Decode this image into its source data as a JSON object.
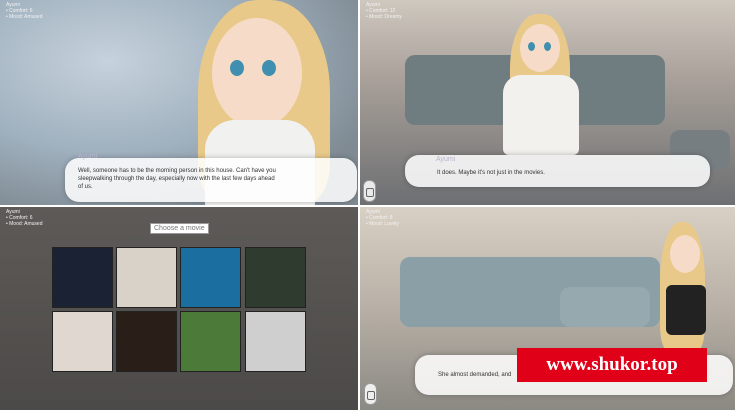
{
  "panel1": {
    "stats": [
      "Ayumi",
      "• Comfort: 6",
      "• Mood: Amused"
    ],
    "speaker": "Ayumi",
    "dialog_line1": "Well, someone has to be the morning person in this house. Can't have you",
    "dialog_line2": "sleepwalking through the day, especially now with the last few days ahead",
    "dialog_line3": "of us."
  },
  "panel2": {
    "stats": [
      "Ayumi",
      "• Comfort: 12",
      "• Mood: Dreamy"
    ],
    "speaker": "Ayumi",
    "dialog_line1": "It does. Maybe it's not just in the movies."
  },
  "panel3": {
    "stats": [
      "Ayumi",
      "• Comfort: 6",
      "• Mood: Amused"
    ],
    "title": "Choose a movie",
    "movies": [
      {
        "name": "movie-thumb-moon-figure",
        "color": "#1b2233"
      },
      {
        "name": "movie-thumb-orb-poster",
        "color": "#d9d2c8"
      },
      {
        "name": "movie-thumb-blue-sphere",
        "color": "#1a6fa0"
      },
      {
        "name": "movie-thumb-green-face",
        "color": "#2f3b2e"
      },
      {
        "name": "movie-thumb-embrace",
        "color": "#e0d8d0"
      },
      {
        "name": "movie-thumb-dark-door",
        "color": "#2a1f18"
      },
      {
        "name": "movie-thumb-children-field",
        "color": "#4c7a38"
      },
      {
        "name": "movie-thumb-bare-tree",
        "color": "#cfcfcf"
      }
    ]
  },
  "panel4": {
    "stats": [
      "Ayumi",
      "• Comfort: 8",
      "• Mood: Lovely"
    ],
    "dialog_line1": "She almost demanded, and"
  },
  "watermark": "www.shukor.top"
}
